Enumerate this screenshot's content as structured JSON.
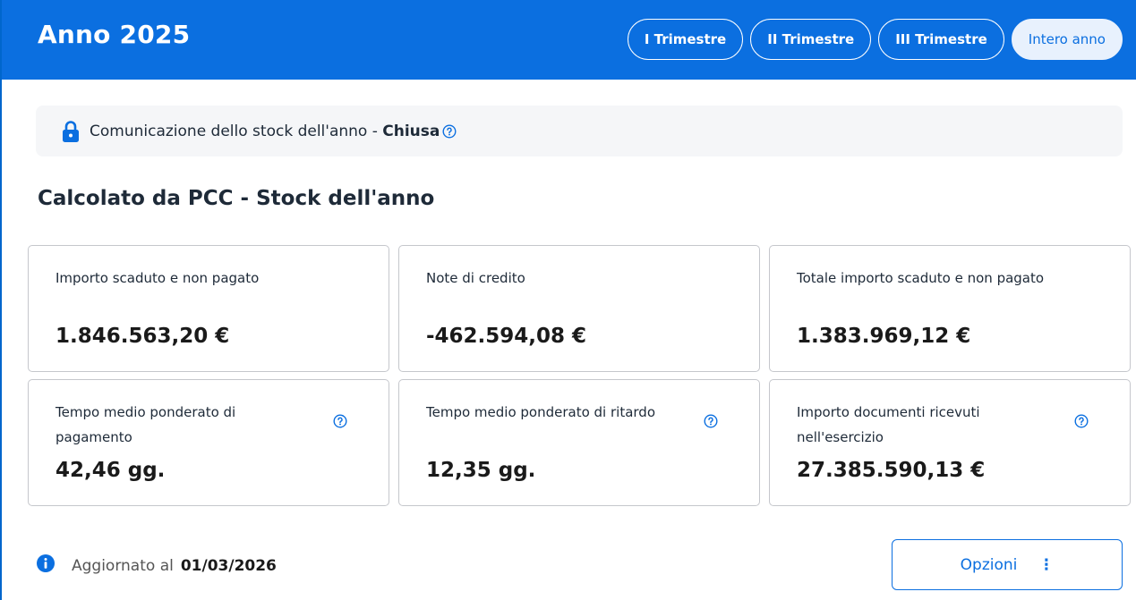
{
  "header": {
    "title": "Anno 2025",
    "tabs": [
      {
        "label": "I Trimestre",
        "active": false
      },
      {
        "label": "II Trimestre",
        "active": false
      },
      {
        "label": "III Trimestre",
        "active": false
      },
      {
        "label": "Intero anno",
        "active": true
      }
    ]
  },
  "notice": {
    "text": "Comunicazione dello stock dell'anno - ",
    "status": "Chiusa",
    "icon": "lock-icon"
  },
  "section": {
    "title": "Calcolato da PCC - Stock dell'anno"
  },
  "cards": [
    {
      "label": "Importo scaduto e non pagato",
      "value": "1.846.563,20 €",
      "help": false
    },
    {
      "label": "Note di credito",
      "value": "-462.594,08 €",
      "help": false
    },
    {
      "label": "Totale importo scaduto e non pagato",
      "value": "1.383.969,12 €",
      "help": false
    },
    {
      "label": "Tempo medio ponderato di pagamento",
      "value": "42,46 gg.",
      "help": true
    },
    {
      "label": "Tempo medio ponderato di ritardo",
      "value": "12,35 gg.",
      "help": true
    },
    {
      "label": "Importo documenti ricevuti nell'esercizio",
      "value": "27.385.590,13 €",
      "help": true
    }
  ],
  "footer": {
    "updated_label": "Aggiornato al",
    "updated_date": "01/03/2026",
    "options_label": "Opzioni",
    "options_dots": "⋮"
  },
  "colors": {
    "primary": "#0b6fe0",
    "notice_bg": "#f5f6f8",
    "card_border": "#c5c7cc"
  }
}
